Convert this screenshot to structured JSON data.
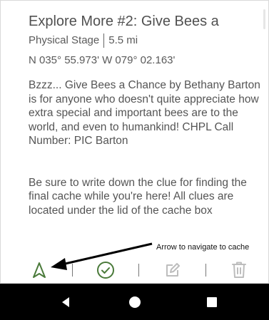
{
  "card": {
    "title": "Explore More #2: Give Bees a",
    "stage": "Physical Stage",
    "distance": "5.5 mi",
    "coordinates": "N 035° 55.973' W 079° 02.163'",
    "description": "Bzzz... Give Bees a Chance by Bethany Barton is for anyone who doesn't quite appreciate how extra special and important bees are to the world, and even to humankind! CHPL Call Number: PIC Barton",
    "clue_note": "Be sure to write down the clue for finding the final cache while you're here! All clues are located under the lid of the cache box"
  },
  "annotation": {
    "text": "Arrow to navigate to cache"
  },
  "actions": [
    {
      "icon": "navigate-arrow-icon",
      "color": "#4a7a3a"
    },
    {
      "icon": "check-circle-icon",
      "color": "#4a7a3a"
    },
    {
      "icon": "edit-icon",
      "color": "#bdbdbd"
    },
    {
      "icon": "trash-icon",
      "color": "#bdbdbd"
    }
  ],
  "nav": {
    "back": "back-icon",
    "home": "home-icon",
    "recents": "recents-icon"
  }
}
